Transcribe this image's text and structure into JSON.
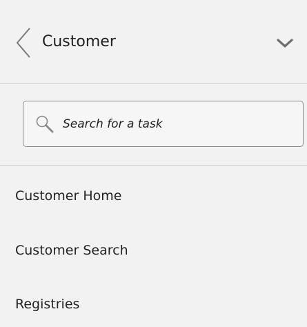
{
  "header": {
    "title": "Customer",
    "back_icon": "chevron-left-icon",
    "collapse_icon": "chevron-down-icon"
  },
  "search": {
    "placeholder": "Search for a task",
    "value": "",
    "icon": "search-icon"
  },
  "tasks": [
    {
      "label": "Customer Home"
    },
    {
      "label": "Customer Search"
    },
    {
      "label": "Registries"
    }
  ],
  "colors": {
    "background": "#f2f2f2",
    "divider": "#cfcfcf",
    "icon": "#6f6f6f",
    "text": "#202020"
  }
}
